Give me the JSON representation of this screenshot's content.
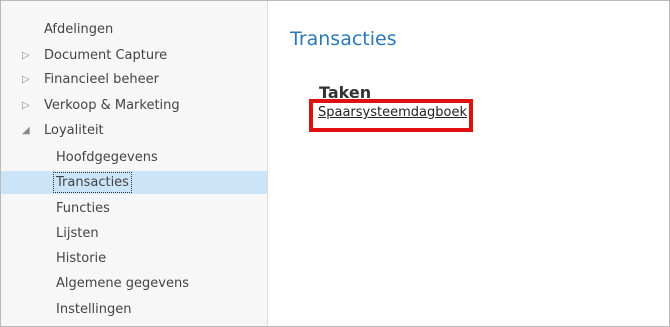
{
  "navigation": {
    "items": [
      {
        "label": "Afdelingen",
        "arrow": ""
      },
      {
        "label": "Document Capture",
        "arrow": "▷"
      },
      {
        "label": "Financieel beheer",
        "arrow": "▷"
      },
      {
        "label": "Verkoop & Marketing",
        "arrow": "▷"
      },
      {
        "label": "Loyaliteit",
        "arrow": "◢"
      },
      {
        "label": "Hoofdgegevens",
        "arrow": ""
      },
      {
        "label": "Transacties",
        "arrow": ""
      },
      {
        "label": "Functies",
        "arrow": ""
      },
      {
        "label": "Lijsten",
        "arrow": ""
      },
      {
        "label": "Historie",
        "arrow": ""
      },
      {
        "label": "Algemene gegevens",
        "arrow": ""
      },
      {
        "label": "Instellingen",
        "arrow": ""
      }
    ],
    "selected": "Transacties"
  },
  "main": {
    "title": "Transacties",
    "section_title": "Taken",
    "link_label": "Spaarsysteemdagboek"
  },
  "colors": {
    "title": "#2c79b7",
    "selection": "#cce4f7",
    "highlight_border": "#e01010"
  }
}
